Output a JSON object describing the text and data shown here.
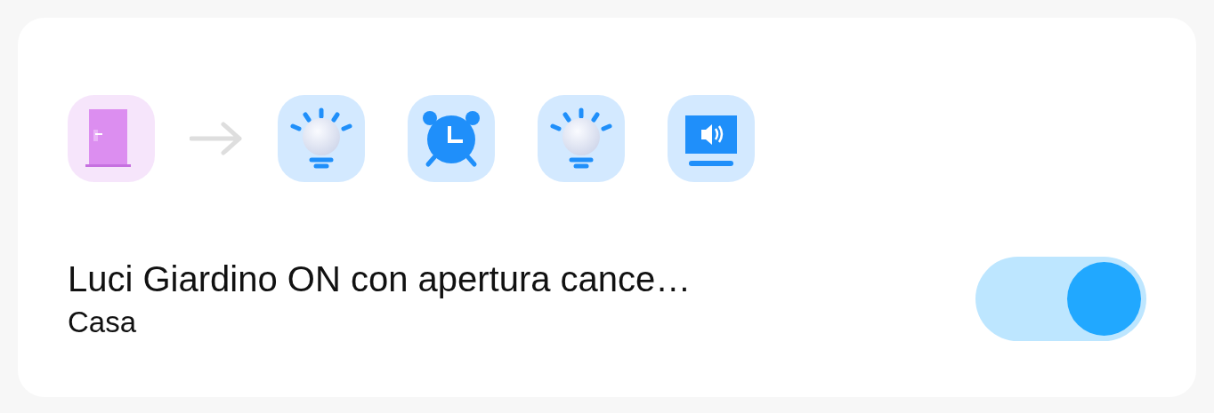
{
  "scene": {
    "trigger": {
      "kind": "door"
    },
    "actions": [
      {
        "kind": "bulb"
      },
      {
        "kind": "alarm"
      },
      {
        "kind": "bulb"
      },
      {
        "kind": "speaker"
      }
    ],
    "title": "Luci Giardino ON con apertura cance…",
    "subtitle": "Casa",
    "on": true
  }
}
